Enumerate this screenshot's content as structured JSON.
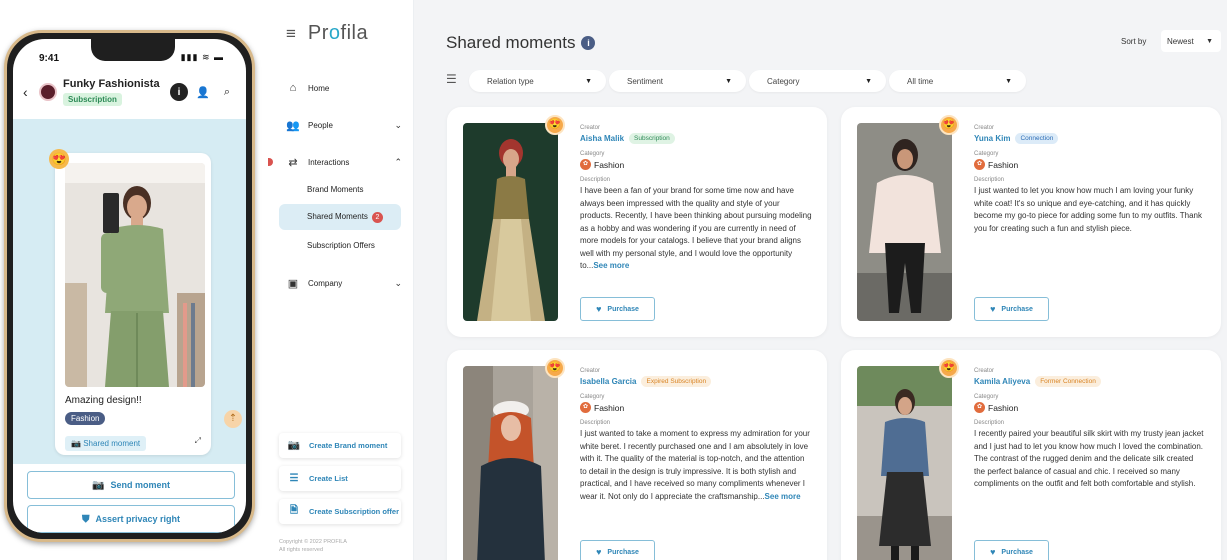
{
  "phone": {
    "status_time": "9:41",
    "status_icons": "▮▮▮ ≋ ▬",
    "back_icon": "‹",
    "contact_name": "Funky Fashionista",
    "contact_badge": "Subscription",
    "info_icon": "i",
    "contact_icon": "👤",
    "search_icon": "⌕",
    "emoji": "😍",
    "caption": "Amazing design!!",
    "tag": "Fashion",
    "shared_label": "Shared moment",
    "shared_icon": "📷",
    "mini_icon": "⤢",
    "float_icon": "⇡",
    "send_button": "Send moment",
    "send_icon": "📷",
    "privacy_button": "Assert privacy right",
    "privacy_icon": "⛊"
  },
  "sidebar": {
    "menu_icon": "≡",
    "logo_prefix": "Pr",
    "logo_o": "o",
    "logo_suffix": "fila",
    "items": [
      {
        "label": "Home",
        "icon": "⌂"
      },
      {
        "label": "People",
        "icon": "👥",
        "chevron": "⌄"
      },
      {
        "label": "Interactions",
        "icon": "⇄",
        "chevron": "⌃"
      },
      {
        "label": "Company",
        "icon": "▣",
        "chevron": "⌄"
      }
    ],
    "sub_items": [
      {
        "label": "Brand Moments"
      },
      {
        "label": "Shared Moments",
        "count": "2"
      },
      {
        "label": "Subscription Offers"
      }
    ],
    "actions": [
      {
        "label": "Create Brand moment",
        "icon": "📷"
      },
      {
        "label": "Create List",
        "icon": "☰"
      },
      {
        "label": "Create Subscription offer",
        "icon": "🗎"
      }
    ],
    "copyright_line1": "Copyright © 2022 PROFILA",
    "copyright_line2": "All rights reserved"
  },
  "main": {
    "title": "Shared moments",
    "info_icon": "i",
    "sort_label": "Sort by",
    "sort_value": "Newest",
    "filter_icon": "☰",
    "filters": [
      "Relation type",
      "Sentiment",
      "Category",
      "All time"
    ],
    "dropdown_arrow": "▼",
    "labels": {
      "creator": "Creator",
      "category": "Category",
      "description": "Description"
    },
    "purchase_label": "Purchase",
    "purchase_icon": "♥",
    "see_more": "See more",
    "cards": [
      {
        "emoji": "😍",
        "creator": "Aisha Malik",
        "relation": "Subscription",
        "category": "Fashion",
        "description": "I have been a fan of your brand for some time now and have always been impressed with the quality and style of your products. Recently, I have been thinking about pursuing modeling as a hobby and was wondering if you are currently in need of more models for your catalogs. I believe that your brand aligns well with my personal style, and I would love the opportunity to..."
      },
      {
        "emoji": "😍",
        "creator": "Yuna Kim",
        "relation": "Connection",
        "category": "Fashion",
        "description": "I just wanted to let you know how much I am loving your funky white coat! It's so unique and eye-catching, and it has quickly become my go-to piece for adding some fun to my outfits. Thank you for creating such a fun and stylish piece."
      },
      {
        "emoji": "😍",
        "creator": "Isabella Garcia",
        "relation": "Expired Subscription",
        "category": "Fashion",
        "description": "I just wanted to take a moment to express my admiration for your white beret. I recently purchased one and I am absolutely in love with it. The quality of the material is top-notch, and the attention to detail in the design is truly impressive. It is both stylish and practical, and I have received so many compliments whenever I wear it. Not only do I appreciate the craftsmanship..."
      },
      {
        "emoji": "😍",
        "creator": "Kamila Aliyeva",
        "relation": "Former Connection",
        "category": "Fashion",
        "description": "I recently paired your beautiful silk skirt with my trusty jean jacket and I just had to let you know how much I loved the combination. The contrast of the rugged denim and the delicate silk created the perfect balance of casual and chic. I received so many compliments on the outfit and felt both comfortable and stylish."
      }
    ]
  },
  "colors": {
    "accent": "#2f86b7",
    "badge_red": "#d9534f",
    "main_bg": "#f3f4f6",
    "phone_bg": "#d6ecf3"
  }
}
